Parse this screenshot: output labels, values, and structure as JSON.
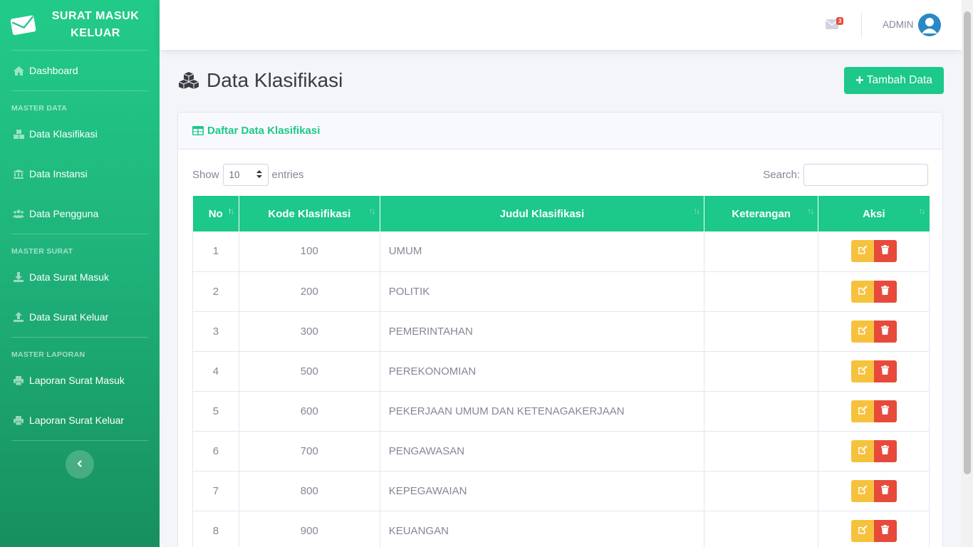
{
  "sidebar": {
    "brand_line1": "SURAT MASUK",
    "brand_line2": "KELUAR",
    "brand_icon": "envelope-icon",
    "dashboard": "Dashboard",
    "heading_master_data": "MASTER DATA",
    "data_klasifikasi": "Data Klasifikasi",
    "data_instansi": "Data Instansi",
    "data_pengguna": "Data Pengguna",
    "heading_master_surat": "MASTER SURAT",
    "data_surat_masuk": "Data Surat Masuk",
    "data_surat_keluar": "Data Surat Keluar",
    "heading_master_laporan": "MASTER LAPORAN",
    "laporan_surat_masuk": "Laporan Surat Masuk",
    "laporan_surat_keluar": "Laporan Surat Keluar"
  },
  "topbar": {
    "mail_badge": "3",
    "user_name": "ADMIN"
  },
  "page": {
    "title": "Data Klasifikasi",
    "add_button": "Tambah Data"
  },
  "card": {
    "header": "Daftar Data Klasifikasi",
    "show_label": "Show",
    "entries_value": "10",
    "entries_label": "entries",
    "search_label": "Search:",
    "search_value": ""
  },
  "table": {
    "columns": [
      "No",
      "Kode Klasifikasi",
      "Judul Klasifikasi",
      "Keterangan",
      "Aksi"
    ],
    "rows": [
      {
        "no": "1",
        "kode": "100",
        "judul": "UMUM",
        "keterangan": ""
      },
      {
        "no": "2",
        "kode": "200",
        "judul": "POLITIK",
        "keterangan": ""
      },
      {
        "no": "3",
        "kode": "300",
        "judul": "PEMERINTAHAN",
        "keterangan": ""
      },
      {
        "no": "4",
        "kode": "500",
        "judul": "PEREKONOMIAN",
        "keterangan": ""
      },
      {
        "no": "5",
        "kode": "600",
        "judul": "PEKERJAAN UMUM DAN KETENAGAKERJAAN",
        "keterangan": ""
      },
      {
        "no": "6",
        "kode": "700",
        "judul": "PENGAWASAN",
        "keterangan": ""
      },
      {
        "no": "7",
        "kode": "800",
        "judul": "KEPEGAWAIAN",
        "keterangan": ""
      },
      {
        "no": "8",
        "kode": "900",
        "judul": "KEUANGAN",
        "keterangan": ""
      }
    ]
  },
  "colors": {
    "accent": "#1cc88a",
    "edit": "#f6c23e",
    "delete": "#e74a3b"
  }
}
